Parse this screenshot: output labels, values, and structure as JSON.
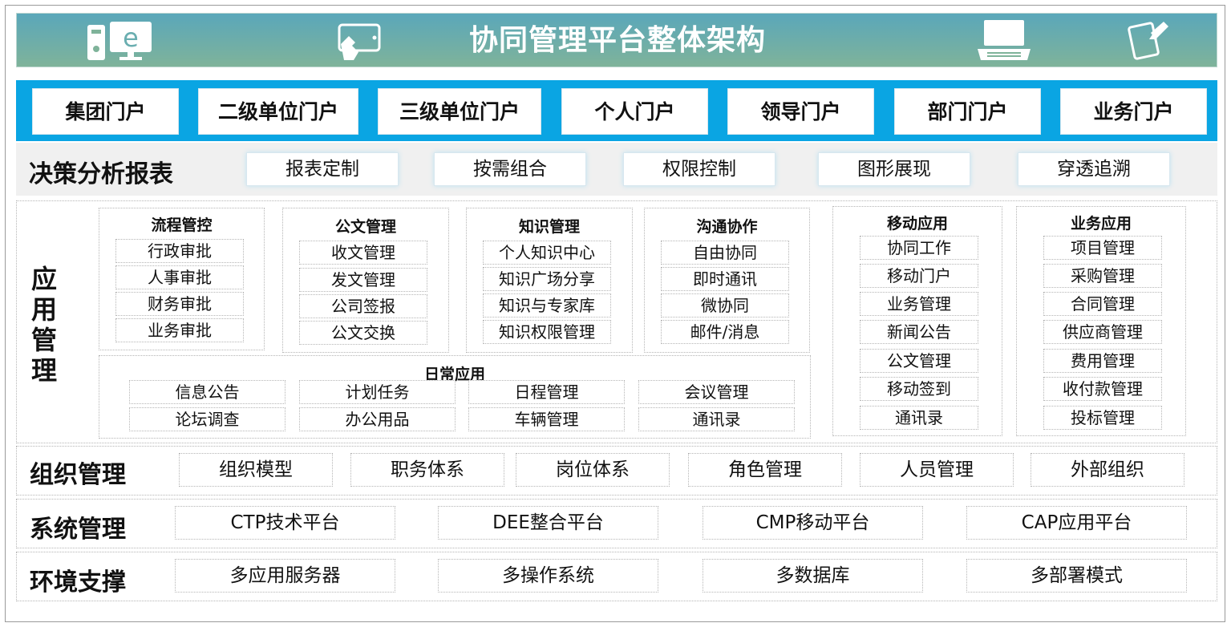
{
  "header": {
    "title": "协同管理平台整体架构",
    "icons": [
      "ie-computer-icon",
      "touch-screen-icon",
      "laptop-icon",
      "tablet-icon"
    ],
    "colors": {
      "gradient_top": "#5aa7ba",
      "gradient_bottom": "#7fb39a",
      "title_text": "#ffffff"
    }
  },
  "portals": {
    "color": "#0aa5e3",
    "items": [
      "集团门户",
      "二级单位门户",
      "三级单位门户",
      "个人门户",
      "领导门户",
      "部门门户",
      "业务门户"
    ]
  },
  "decision": {
    "title": "决策分析报表",
    "items": [
      "报表定制",
      "按需组合",
      "权限控制",
      "图形展现",
      "穿透追溯"
    ]
  },
  "app": {
    "title": "应用管理",
    "title_chars": [
      "应",
      "用",
      "管",
      "理"
    ],
    "groups": [
      {
        "title": "流程管控",
        "items": [
          "行政审批",
          "人事审批",
          "财务审批",
          "业务审批"
        ]
      },
      {
        "title": "公文管理",
        "items": [
          "收文管理",
          "发文管理",
          "公司签报",
          "公文交换"
        ]
      },
      {
        "title": "知识管理",
        "items": [
          "个人知识中心",
          "知识广场分享",
          "知识与专家库",
          "知识权限管理"
        ]
      },
      {
        "title": "沟通协作",
        "items": [
          "自由协同",
          "即时通讯",
          "微协同",
          "邮件/消息"
        ]
      }
    ],
    "daily": {
      "title": "日常应用",
      "items": [
        "信息公告",
        "计划任务",
        "日程管理",
        "会议管理",
        "论坛调查",
        "办公用品",
        "车辆管理",
        "通讯录"
      ]
    },
    "mobile": {
      "title": "移动应用",
      "items": [
        "协同工作",
        "移动门户",
        "业务管理",
        "新闻公告",
        "公文管理",
        "移动签到",
        "通讯录"
      ]
    },
    "business": {
      "title": "业务应用",
      "items": [
        "项目管理",
        "采购管理",
        "合同管理",
        "供应商管理",
        "费用管理",
        "收付款管理",
        "投标管理"
      ]
    }
  },
  "org": {
    "title": "组织管理",
    "items": [
      "组织模型",
      "职务体系",
      "岗位体系",
      "角色管理",
      "人员管理",
      "外部组织"
    ]
  },
  "system": {
    "title": "系统管理",
    "items": [
      "CTP技术平台",
      "DEE整合平台",
      "CMP移动平台",
      "CAP应用平台"
    ]
  },
  "env": {
    "title": "环境支撑",
    "items": [
      "多应用服务器",
      "多操作系统",
      "多数据库",
      "多部署模式"
    ]
  }
}
